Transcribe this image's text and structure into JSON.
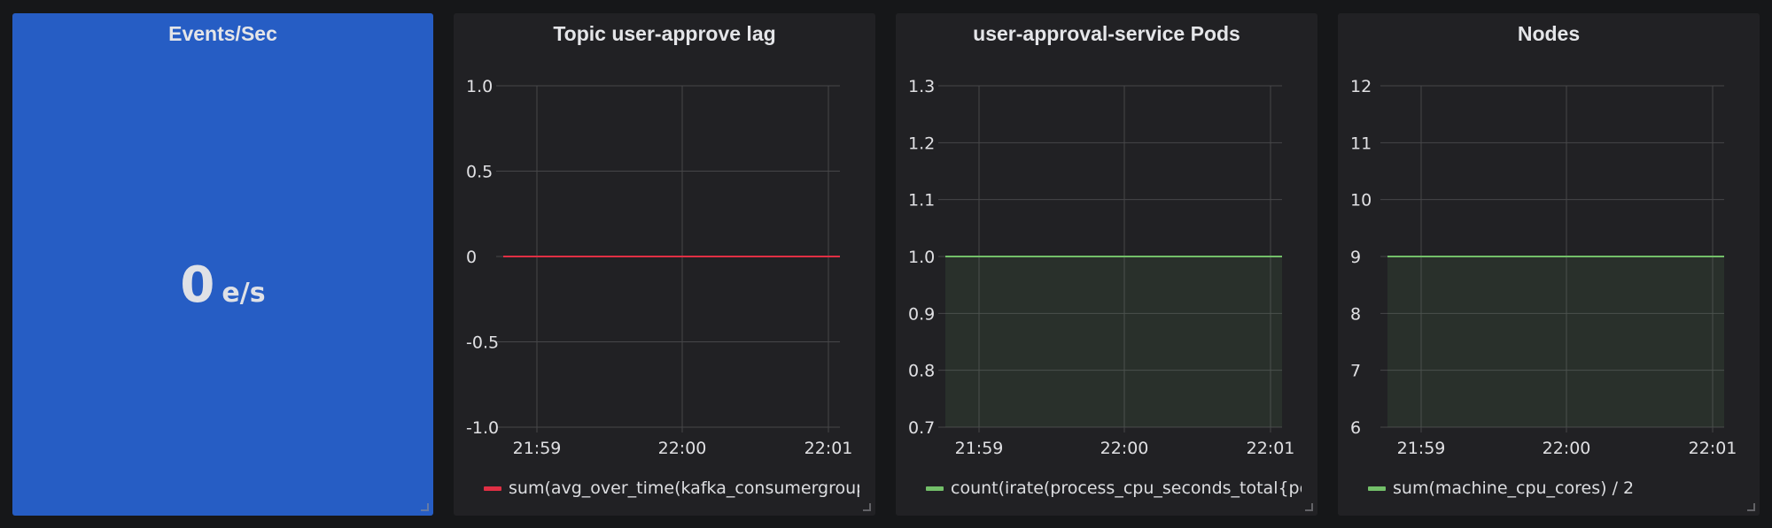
{
  "panels": {
    "events": {
      "title": "Events/Sec",
      "value": "0",
      "unit": "e/s",
      "background": "#265dc4"
    },
    "lag": {
      "title": "Topic user-approve lag",
      "legend": "sum(avg_over_time(kafka_consumergroup_l"
    },
    "pods": {
      "title": "user-approval-service Pods",
      "legend": "count(irate(process_cpu_seconds_total{pod"
    },
    "nodes": {
      "title": "Nodes",
      "legend": "sum(machine_cpu_cores) / 2"
    }
  },
  "colors": {
    "red_series": "#e02f44",
    "green_series": "#73bf69",
    "grid": "#464649",
    "panel_bg": "#212124",
    "page_bg": "#161719"
  },
  "chart_data": [
    {
      "type": "line",
      "title": "Topic user-approve lag",
      "x": [
        "21:59",
        "22:00",
        "22:01"
      ],
      "y_ticks": [
        "1.0",
        "0.5",
        "0",
        "-0.5",
        "-1.0"
      ],
      "ylim": [
        -1.0,
        1.0
      ],
      "grid": true,
      "legend_position": "bottom",
      "series": [
        {
          "name": "sum(avg_over_time(kafka_consumergroup_l",
          "color": "#e02f44",
          "fill": false,
          "values": [
            0,
            0,
            0
          ]
        }
      ]
    },
    {
      "type": "area",
      "title": "user-approval-service Pods",
      "x": [
        "21:59",
        "22:00",
        "22:01"
      ],
      "y_ticks": [
        "1.3",
        "1.2",
        "1.1",
        "1.0",
        "0.9",
        "0.8",
        "0.7"
      ],
      "ylim": [
        0.7,
        1.3
      ],
      "grid": true,
      "legend_position": "bottom",
      "series": [
        {
          "name": "count(irate(process_cpu_seconds_total{pod",
          "color": "#73bf69",
          "fill": true,
          "values": [
            1,
            1,
            1
          ]
        }
      ]
    },
    {
      "type": "area",
      "title": "Nodes",
      "x": [
        "21:59",
        "22:00",
        "22:01"
      ],
      "y_ticks": [
        "12",
        "11",
        "10",
        "9",
        "8",
        "7",
        "6"
      ],
      "ylim": [
        6,
        12
      ],
      "grid": true,
      "legend_position": "bottom",
      "series": [
        {
          "name": "sum(machine_cpu_cores) / 2",
          "color": "#73bf69",
          "fill": true,
          "values": [
            9,
            9,
            9
          ]
        }
      ]
    }
  ]
}
